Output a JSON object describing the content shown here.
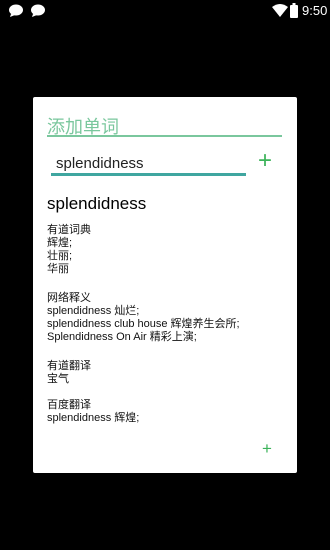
{
  "statusbar": {
    "time": "9:50",
    "icons": [
      "notification-icon",
      "notification-icon",
      "wifi-icon",
      "battery-icon"
    ]
  },
  "dialog": {
    "title": "添加单词",
    "input": {
      "value": "splendidness",
      "placeholder": ""
    },
    "add_top_icon": "+",
    "headword": "splendidness",
    "sections": [
      {
        "title": "有道词典",
        "lines": [
          "辉煌;",
          "壮丽;",
          "华丽"
        ]
      },
      {
        "title": "网络释义",
        "lines": [
          "splendidness 灿烂;",
          "splendidness club house 辉煌养生会所;",
          "Splendidness On Air 精彩上演;"
        ]
      },
      {
        "title": "有道翻译",
        "lines": [
          "宝气"
        ]
      },
      {
        "title": "百度翻译",
        "lines": [
          "splendidness 辉煌;"
        ]
      }
    ],
    "add_bottom_icon": "+"
  },
  "colors": {
    "accent_green": "#7ac79d",
    "input_underline": "#3fa6a0",
    "plus_green": "#3cb35a"
  }
}
